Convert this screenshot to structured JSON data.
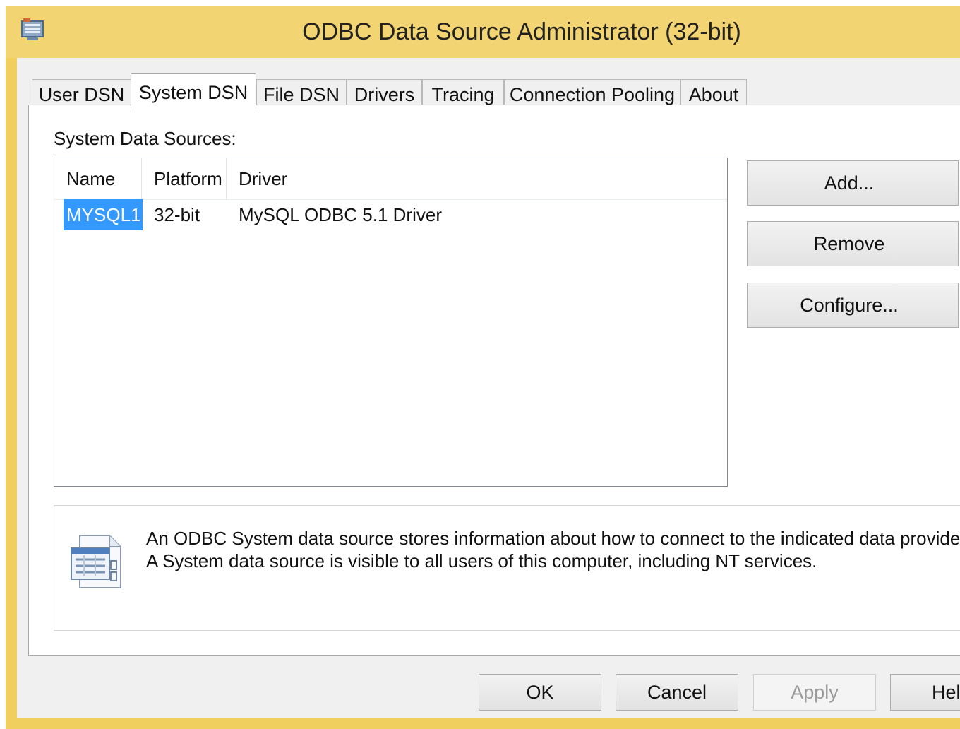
{
  "window": {
    "title": "ODBC Data Source Administrator (32-bit)"
  },
  "tabs": [
    {
      "label": "User DSN",
      "active": false
    },
    {
      "label": "System DSN",
      "active": true
    },
    {
      "label": "File DSN",
      "active": false
    },
    {
      "label": "Drivers",
      "active": false
    },
    {
      "label": "Tracing",
      "active": false
    },
    {
      "label": "Connection Pooling",
      "active": false
    },
    {
      "label": "About",
      "active": false
    }
  ],
  "system_dsn": {
    "section_label": "System Data Sources:",
    "columns": [
      "Name",
      "Platform",
      "Driver"
    ],
    "rows": [
      {
        "name": "MYSQL1",
        "platform": "32-bit",
        "driver": "MySQL ODBC 5.1 Driver",
        "selected": true
      }
    ],
    "buttons": {
      "add": "Add...",
      "remove": "Remove",
      "configure": "Configure..."
    },
    "info": {
      "line1": "An ODBC System data source stores information about how to connect to the indicated data provider.",
      "line2": "A System data source is visible to all users of this computer, including NT services."
    }
  },
  "dialog_buttons": {
    "ok": "OK",
    "cancel": "Cancel",
    "apply": "Apply",
    "help": "Help"
  },
  "colors": {
    "title_bar": "#f3d472",
    "selection": "#3399ff"
  },
  "icons": {
    "app": "odbc-admin-icon",
    "info": "data-source-icon"
  }
}
